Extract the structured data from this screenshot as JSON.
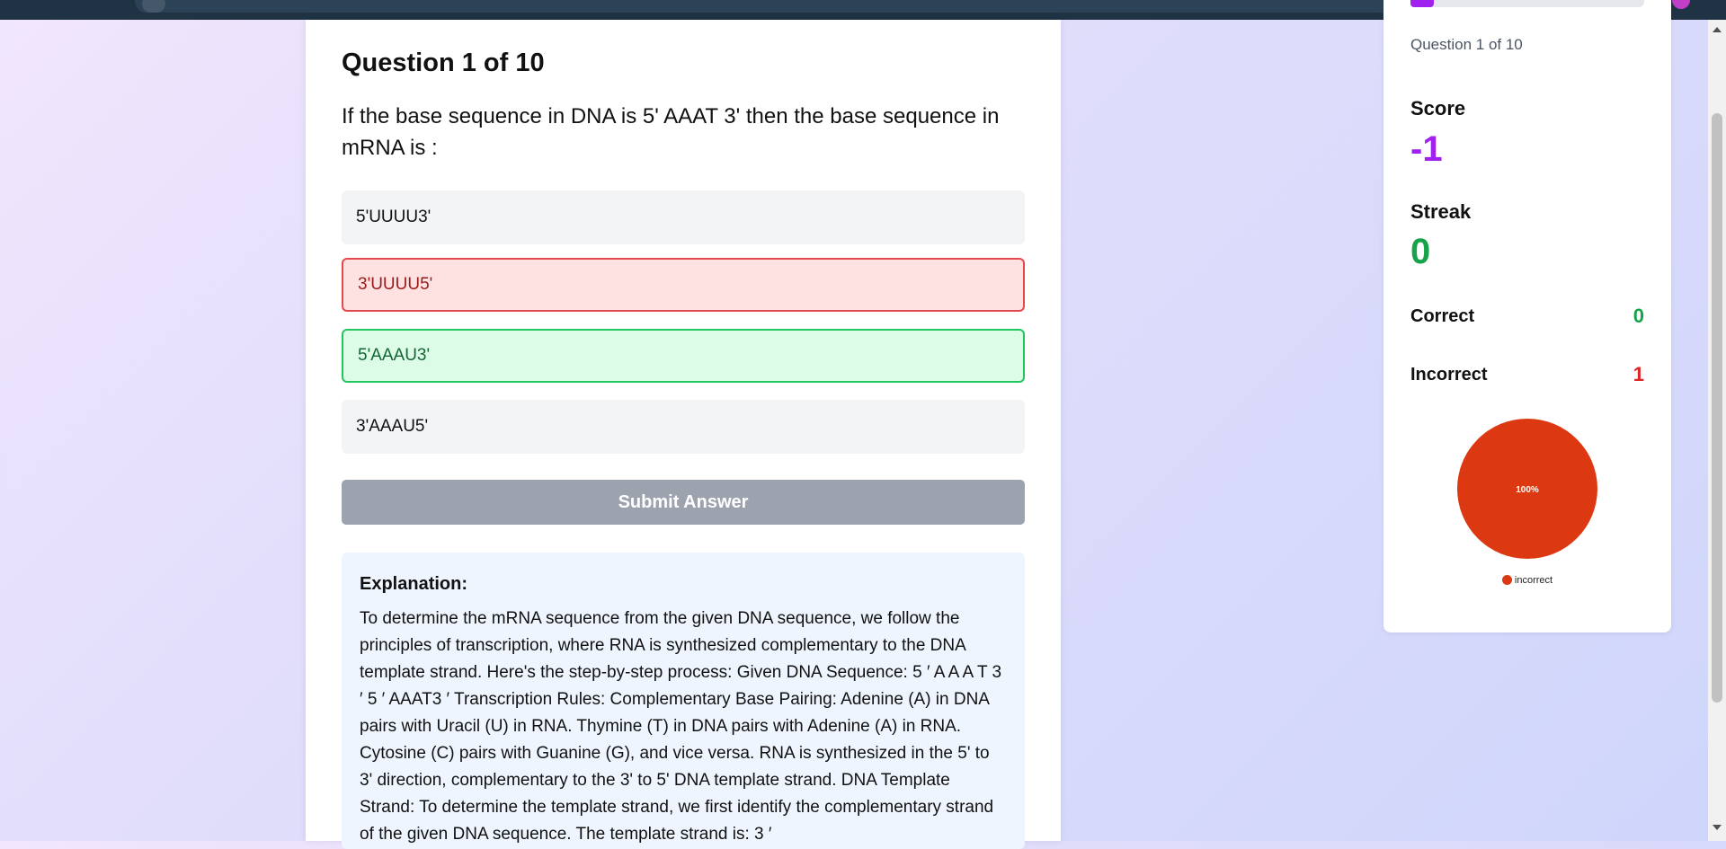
{
  "quiz": {
    "title": "Question 1 of 10",
    "question": "If the base sequence in DNA is 5' AAAT 3' then the base sequence in mRNA is :",
    "options": [
      {
        "label": "5'UUUU3'",
        "state": "default"
      },
      {
        "label": "3'UUUU5'",
        "state": "incorrect"
      },
      {
        "label": "5'AAAU3'",
        "state": "correct"
      },
      {
        "label": "3'AAAU5'",
        "state": "default"
      }
    ],
    "submit_label": "Submit Answer",
    "explanation_title": "Explanation:",
    "explanation_text": "To determine the mRNA sequence from the given DNA sequence, we follow the principles of transcription, where RNA is synthesized complementary to the DNA template strand. Here's the step-by-step process: Given DNA Sequence: 5 ′   A A A T   3 ′ 5 ′ AAAT3 ′ Transcription Rules: Complementary Base Pairing: Adenine (A) in DNA pairs with Uracil (U) in RNA. Thymine (T) in DNA pairs with Adenine (A) in RNA. Cytosine (C) pairs with Guanine (G), and vice versa. RNA is synthesized in the 5' to 3' direction, complementary to the 3' to 5' DNA template strand. DNA Template Strand: To determine the template strand, we first identify the complementary strand of the given DNA sequence. The template strand is: 3 ′"
  },
  "sidebar": {
    "progress_fraction": 0.1,
    "question_label": "Question 1 of 10",
    "score_label": "Score",
    "score_value": "-1",
    "streak_label": "Streak",
    "streak_value": "0",
    "correct_label": "Correct",
    "correct_value": "0",
    "incorrect_label": "Incorrect",
    "incorrect_value": "1"
  },
  "colors": {
    "accent_purple": "#a020f0",
    "correct_green": "#16a34a",
    "incorrect_red": "#dc2626",
    "pie_incorrect": "#dc3912"
  },
  "chart_data": {
    "type": "pie",
    "labels": [
      "incorrect"
    ],
    "values": [
      1
    ],
    "data_labels": [
      "100%"
    ],
    "legend_position": "bottom"
  }
}
